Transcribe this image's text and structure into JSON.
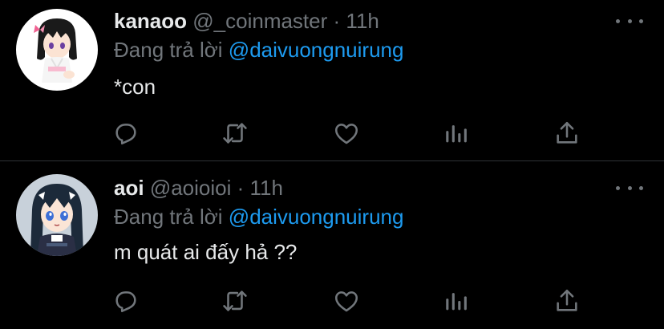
{
  "colors": {
    "background": "#000000",
    "divider": "#2f3336",
    "primary_text": "#e7e9ea",
    "secondary_text": "#71767b",
    "accent": "#1d9bf0"
  },
  "tweets": [
    {
      "display_name": "kanaoo",
      "handle": "@_coinmaster",
      "separator": "·",
      "time": "11h",
      "reply_prefix": "Đang trả lời",
      "reply_to": "@daivuongnuirung",
      "text": "*con",
      "avatar_icon": "anime-avatar-kanao",
      "actions": [
        "reply-icon",
        "retweet-icon",
        "like-icon",
        "analytics-icon",
        "share-icon"
      ]
    },
    {
      "display_name": "aoi",
      "handle": "@aoioioi",
      "separator": "·",
      "time": "11h",
      "reply_prefix": "Đang trả lời",
      "reply_to": "@daivuongnuirung",
      "text": "m quát ai đấy hả ??",
      "avatar_icon": "anime-avatar-aoi",
      "actions": [
        "reply-icon",
        "retweet-icon",
        "like-icon",
        "analytics-icon",
        "share-icon"
      ]
    }
  ]
}
